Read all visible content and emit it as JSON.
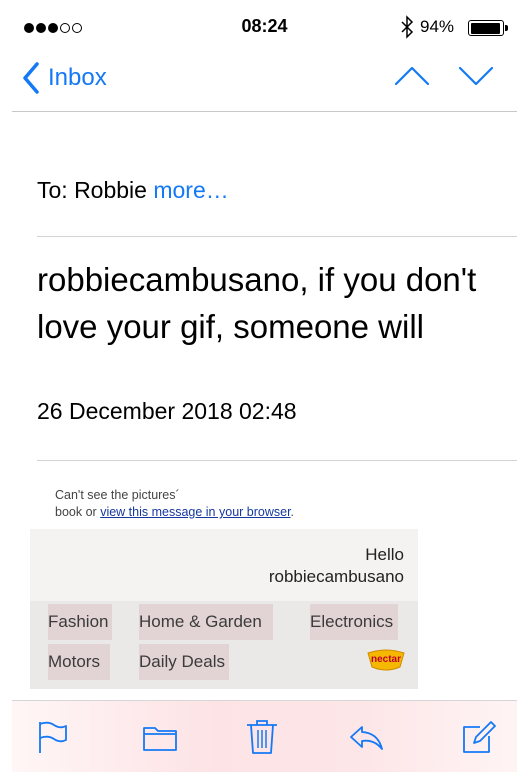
{
  "status_bar": {
    "time": "08:24",
    "battery_percent": "94%",
    "signal_bars_filled": 3,
    "signal_bars_total": 5,
    "battery_level": 0.94
  },
  "nav": {
    "back_label": "Inbox"
  },
  "header": {
    "to_prefix": "To: Robbie",
    "more_label": "more…",
    "subject": "robbiecambusano, if you don't love your gif, someone will",
    "date": "26 December 2018 02:48"
  },
  "body": {
    "cant_see_line1": "Can't see the pictures",
    "cant_see_line2_prefix": "book or",
    "cant_see_link": "view this message in your browser",
    "cant_see_line2_suffix": ".",
    "hello": "Hello",
    "username": "robbiecambusano",
    "categories": [
      "Fashion",
      "Home & Garden",
      "Electronics",
      "Motors",
      "Daily Deals"
    ],
    "nectar_label": "nectar"
  },
  "colors": {
    "accent": "#1479f6",
    "link": "#15389e",
    "nectar": "#f5b700"
  },
  "toolbar": {
    "icons": [
      "flag-icon",
      "folder-icon",
      "trash-icon",
      "reply-icon",
      "compose-icon"
    ]
  }
}
